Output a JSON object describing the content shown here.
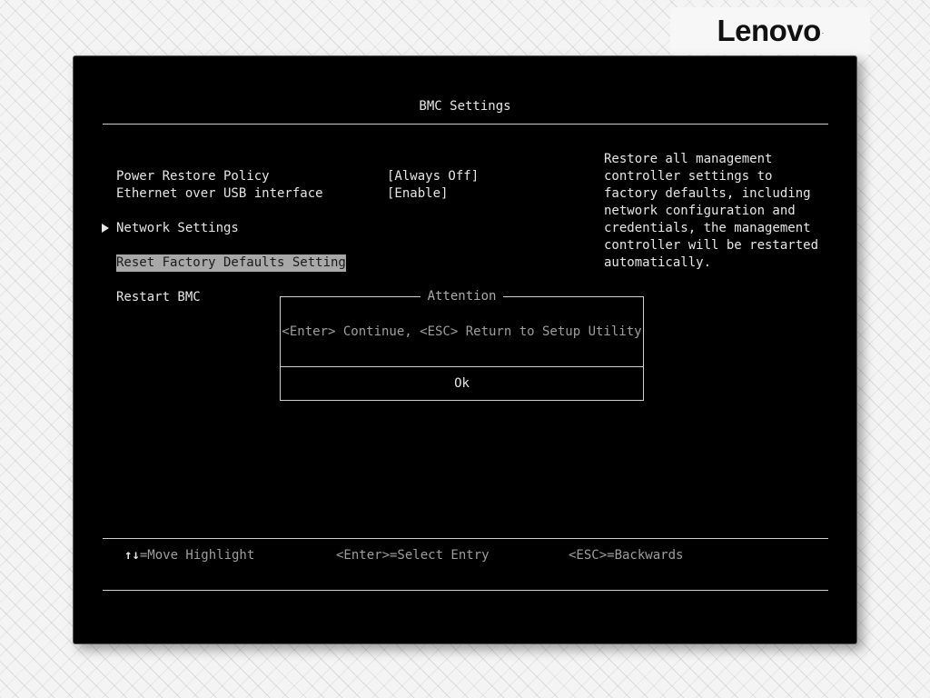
{
  "brand": {
    "logo_text": "Lenovo",
    "logo_mark": "."
  },
  "screen": {
    "title": "BMC Settings"
  },
  "menu": {
    "items": [
      {
        "label": "Power Restore Policy",
        "value": "[Always Off]"
      },
      {
        "label": "Ethernet over USB interface",
        "value": "[Enable]"
      },
      {
        "label": "Network Settings",
        "submenu": true
      },
      {
        "label": "Reset Factory Defaults Setting",
        "selected": true
      },
      {
        "label": "Restart BMC"
      }
    ]
  },
  "help_text": "Restore all management controller settings to factory defaults, including network configuration and credentials, the management controller will be restarted automatically.",
  "dialog": {
    "title": "Attention",
    "message": "<Enter> Continue, <ESC> Return to Setup Utility",
    "button": "Ok"
  },
  "footer": {
    "move_arrows": "↑↓",
    "move": "=Move Highlight",
    "select": "<Enter>=Select Entry",
    "back": "<ESC>=Backwards"
  },
  "colors": {
    "background": "#000000",
    "text": "#e6e6e6",
    "highlight": "#a8a8a8",
    "dim_text": "#9e9e9e"
  }
}
